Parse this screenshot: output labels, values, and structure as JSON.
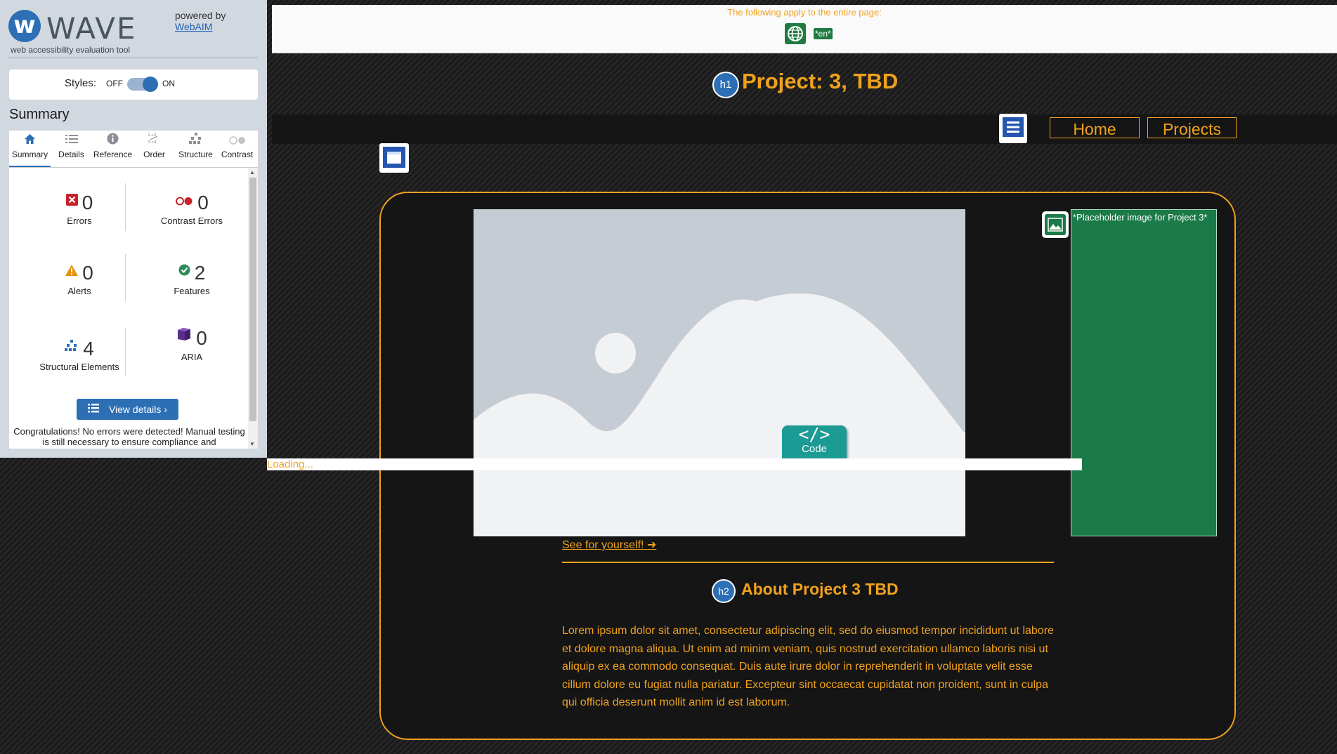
{
  "wave": {
    "logo_letter": "w",
    "logo_text": "WAVE",
    "tagline": "web accessibility evaluation tool",
    "powered_by": "powered by",
    "webaim_link": "WebAIM",
    "styles_label": "Styles:",
    "styles_off": "OFF",
    "styles_on": "ON",
    "styles_state": "on",
    "summary_heading": "Summary",
    "tabs": [
      {
        "label": "Summary",
        "icon": "home-icon",
        "active": true
      },
      {
        "label": "Details",
        "icon": "list-icon",
        "active": false
      },
      {
        "label": "Reference",
        "icon": "info-icon",
        "active": false
      },
      {
        "label": "Order",
        "icon": "order-icon",
        "active": false
      },
      {
        "label": "Structure",
        "icon": "structure-icon",
        "active": false
      },
      {
        "label": "Contrast",
        "icon": "contrast-icon",
        "active": false
      }
    ],
    "stats": {
      "errors": {
        "count": "0",
        "label": "Errors"
      },
      "contrast_errors": {
        "count": "0",
        "label": "Contrast Errors"
      },
      "alerts": {
        "count": "0",
        "label": "Alerts"
      },
      "features": {
        "count": "2",
        "label": "Features"
      },
      "structural": {
        "count": "4",
        "label": "Structural Elements"
      },
      "aria": {
        "count": "0",
        "label": "ARIA"
      }
    },
    "view_details": "View details ›",
    "congrats": "Congratulations! No errors were detected! Manual testing is still necessary to ensure compliance and"
  },
  "banner": {
    "text": "The following apply to the entire page:",
    "lang_tag": "*en*"
  },
  "page": {
    "h1_badge": "h1",
    "title": "Project: 3, TBD",
    "nav": {
      "home": "Home",
      "projects": "Projects"
    },
    "image_alt": "*Placeholder image for Project 3*",
    "code_symbol": "</>",
    "code_label": "Code",
    "loading": "Loading...",
    "see_link": "See for yourself! ➜",
    "h2_badge": "h2",
    "about_title": "About Project 3 TBD",
    "lorem": "Lorem ipsum dolor sit amet, consectetur adipiscing elit, sed do eiusmod tempor incididunt ut labore et dolore magna aliqua. Ut enim ad minim veniam, quis nostrud exercitation ullamco laboris nisi ut aliquip ex ea commodo consequat. Duis aute irure dolor in reprehenderit in voluptate velit esse cillum dolore eu fugiat nulla pariatur. Excepteur sint occaecat cupidatat non proident, sunt in culpa qui officia deserunt mollit anim id est laborum."
  },
  "colors": {
    "accent": "#f0a21e",
    "wave_blue": "#2d6fb5",
    "feature_green": "#1a7a48",
    "code_teal": "#1c9a94"
  }
}
